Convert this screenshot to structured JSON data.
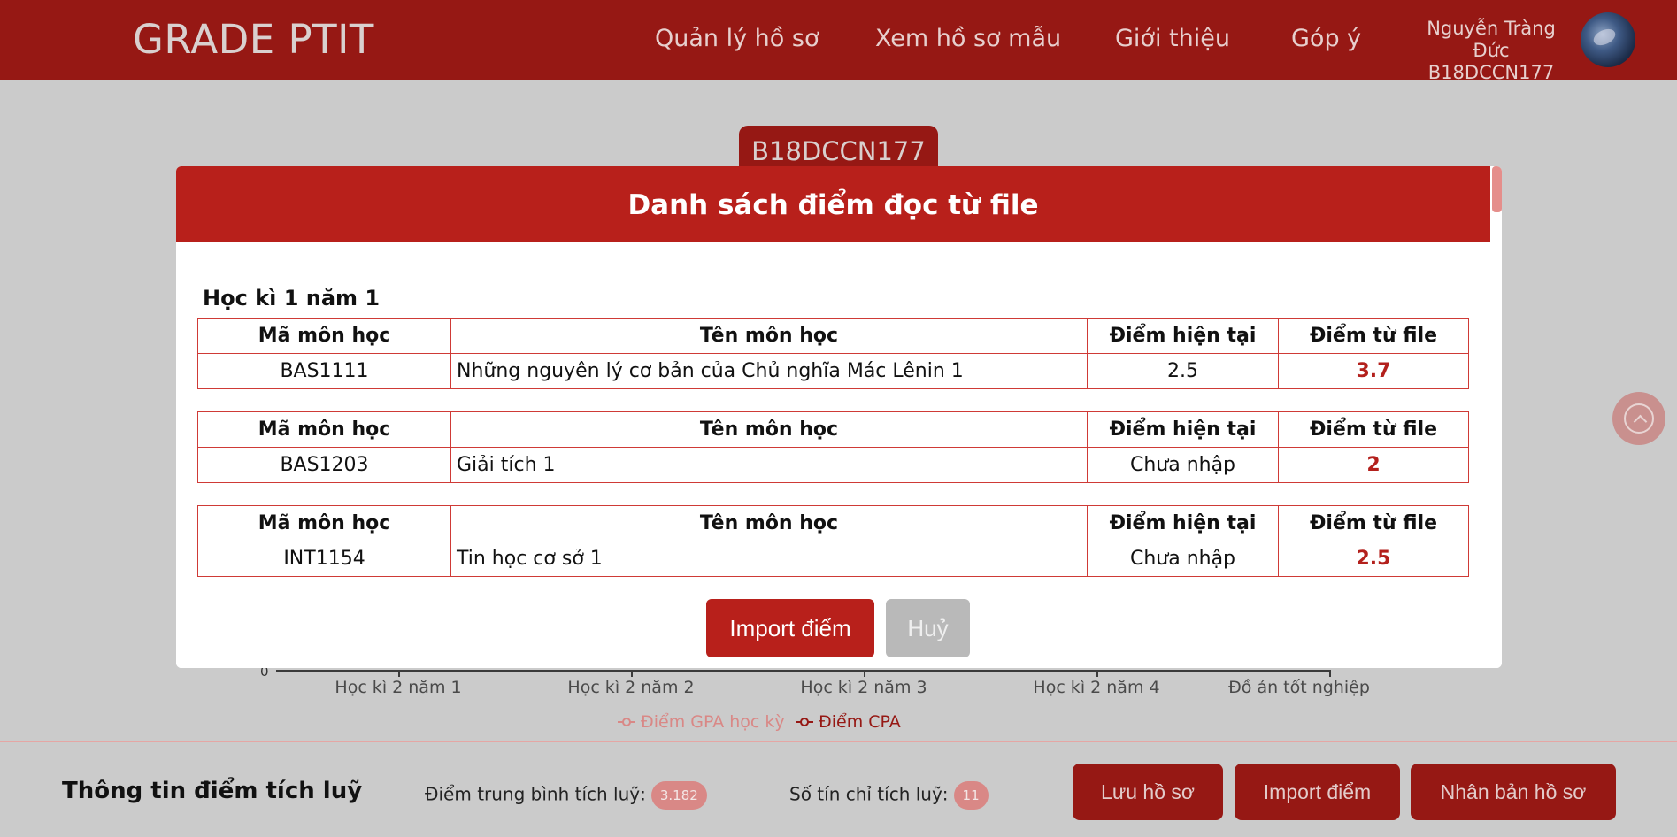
{
  "header": {
    "logo": "GRADE PTIT",
    "nav": [
      "Quản lý hồ sơ",
      "Xem hồ sơ mẫu",
      "Giới thiệu",
      "Góp ý"
    ],
    "user": {
      "name": "Nguyễn Tràng Đức",
      "id": "B18DCCN177"
    }
  },
  "background": {
    "student_tab": "B18DCCN177",
    "chart": {
      "zero": "0",
      "xticks": [
        "Học kì 2 năm 1",
        "Học kì 2 năm 2",
        "Học kì 2 năm 3",
        "Học kì 2 năm 4",
        "Đồ án tốt nghiệp"
      ],
      "legend": [
        {
          "label": "Điểm GPA học kỳ",
          "color": "#d98886"
        },
        {
          "label": "Điểm CPA",
          "color": "#961814"
        }
      ]
    }
  },
  "bottom_bar": {
    "title": "Thông tin điểm tích luỹ",
    "gpa_label": "Điểm trung bình tích luỹ:",
    "gpa_value": "3.182",
    "credits_label": "Số tín chỉ tích luỹ:",
    "credits_value": "11",
    "buttons": [
      "Lưu hồ sơ",
      "Import điểm",
      "Nhân bản hồ sơ"
    ]
  },
  "modal": {
    "title": "Danh sách điểm đọc từ file",
    "section": "Học kì 1 năm 1",
    "columns": [
      "Mã môn học",
      "Tên môn học",
      "Điểm hiện tại",
      "Điểm từ file"
    ],
    "rows": [
      {
        "code": "BAS1111",
        "name": "Những nguyên lý cơ bản của Chủ nghĩa Mác Lênin 1",
        "current": "2.5",
        "file": "3.7"
      },
      {
        "code": "BAS1203",
        "name": "Giải tích 1",
        "current": "Chưa nhập",
        "file": "2"
      },
      {
        "code": "INT1154",
        "name": "Tin học cơ sở 1",
        "current": "Chưa nhập",
        "file": "2.5"
      }
    ],
    "import_button": "Import điểm",
    "cancel_button": "Huỷ"
  },
  "colors": {
    "brand": "#961814",
    "modal_header": "#b8201b",
    "accent_light": "#d98886"
  }
}
